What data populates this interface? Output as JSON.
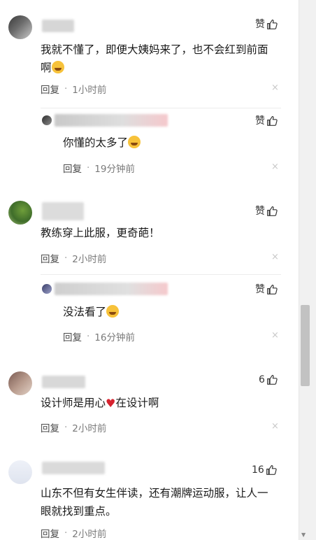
{
  "comments": [
    {
      "text_line1": "我就不懂了，即便大姨妈来了，也不会红到前面",
      "text_line2": "啊",
      "like_label": "赞",
      "reply_label": "回复",
      "time": "1小时前",
      "reply": {
        "text": "你懂的太多了",
        "like_label": "赞",
        "reply_label": "回复",
        "time": "19分钟前"
      }
    },
    {
      "text": "教练穿上此服，更奇葩！",
      "like_label": "赞",
      "reply_label": "回复",
      "time": "2小时前",
      "reply": {
        "text": "没法看了",
        "like_label": "赞",
        "reply_label": "回复",
        "time": "16分钟前"
      }
    },
    {
      "text_before": "设计师是用心",
      "text_after": "在设计啊",
      "like_count": "6",
      "reply_label": "回复",
      "time": "2小时前"
    },
    {
      "text_line1": "山东不但有女生伴读，还有潮牌运动服，让人一",
      "text_line2": "眼就找到重点。",
      "like_count": "16",
      "reply_label": "回复",
      "time": "2小时前"
    }
  ],
  "separator": "·",
  "close_symbol": "×",
  "icons": {
    "like": "thumbs-up-icon",
    "close": "close-icon",
    "laugh": "laughing-emoji",
    "heart": "heart-emoji"
  },
  "colors": {
    "text": "#1a1a1a",
    "meta": "#7a7a7a",
    "heart": "#d6222e"
  }
}
